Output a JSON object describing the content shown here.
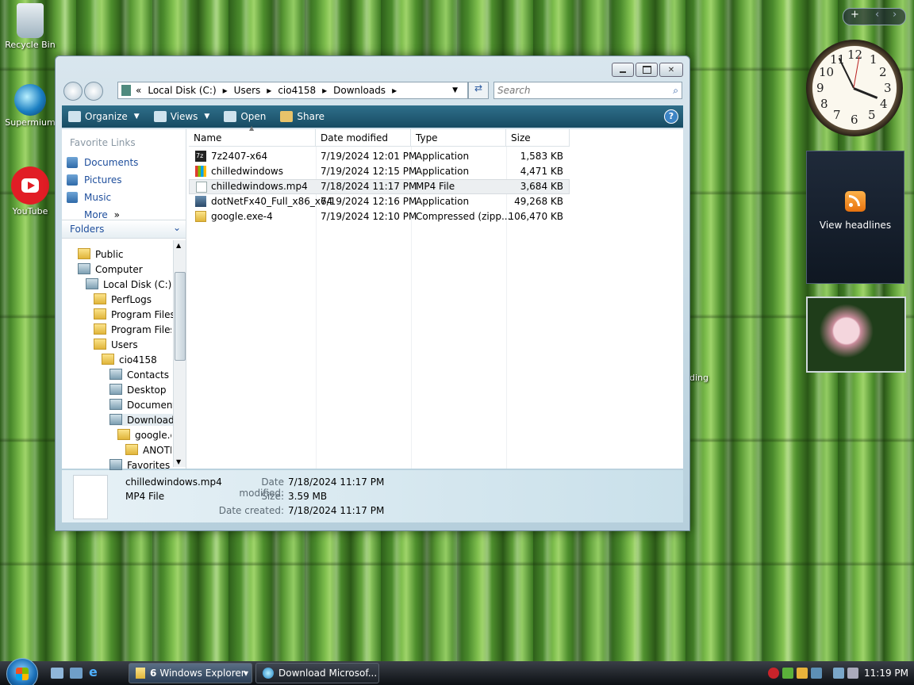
{
  "desktop": {
    "icons": [
      {
        "label": "Recycle Bin"
      },
      {
        "label": "Supermium"
      },
      {
        "label": "YouTube"
      }
    ],
    "partial_label": "nding"
  },
  "window": {
    "address": {
      "chevron": "«",
      "parts": [
        "Local Disk (C:)",
        "Users",
        "cio4158",
        "Downloads"
      ]
    },
    "search_placeholder": "Search",
    "toolbar": {
      "organize": "Organize",
      "views": "Views",
      "open": "Open",
      "share": "Share",
      "help": "?"
    },
    "favorite_links": {
      "title": "Favorite Links",
      "items": [
        "Documents",
        "Pictures",
        "Music",
        "More"
      ],
      "more_suffix": "»"
    },
    "folders_label": "Folders",
    "tree": [
      "Public",
      "Computer",
      "Local Disk (C:)",
      "PerfLogs",
      "Program Files",
      "Program Files (",
      "Users",
      "cio4158",
      "Contacts",
      "Desktop",
      "Document",
      "Downloads",
      "google.e",
      "ANOTH",
      "Favorites"
    ],
    "columns": {
      "name": "Name",
      "date": "Date modified",
      "type": "Type",
      "size": "Size"
    },
    "files": [
      {
        "name": "7z2407-x64",
        "date": "7/19/2024 12:01 PM",
        "type": "Application",
        "size": "1,583 KB"
      },
      {
        "name": "chilledwindows",
        "date": "7/19/2024 12:15 PM",
        "type": "Application",
        "size": "4,471 KB"
      },
      {
        "name": "chilledwindows.mp4",
        "date": "7/18/2024 11:17 PM",
        "type": "MP4 File",
        "size": "3,684 KB"
      },
      {
        "name": "dotNetFx40_Full_x86_x64",
        "date": "7/19/2024 12:16 PM",
        "type": "Application",
        "size": "49,268 KB"
      },
      {
        "name": "google.exe-4",
        "date": "7/19/2024 12:10 PM",
        "type": "Compressed (zipp...",
        "size": "106,470 KB"
      }
    ],
    "details": {
      "filename": "chilledwindows.mp4",
      "filetype": "MP4 File",
      "modified_label": "Date modified:",
      "modified": "7/18/2024 11:17 PM",
      "size_label": "Size:",
      "size": "3.59 MB",
      "created_label": "Date created:",
      "created": "7/18/2024 11:17 PM"
    }
  },
  "gadgets": {
    "clock_numbers": [
      "12",
      "1",
      "2",
      "3",
      "4",
      "5",
      "6",
      "7",
      "8",
      "9",
      "10",
      "11"
    ],
    "rss_text": "View headlines",
    "sidebar_add": "+",
    "sidebar_prev": "‹",
    "sidebar_next": "›"
  },
  "taskbar": {
    "buttons": [
      {
        "count": "6",
        "label": "Windows Explorer",
        "dropdown": "▾"
      },
      {
        "label": "Download Microsof..."
      }
    ],
    "time": "11:19 PM"
  }
}
